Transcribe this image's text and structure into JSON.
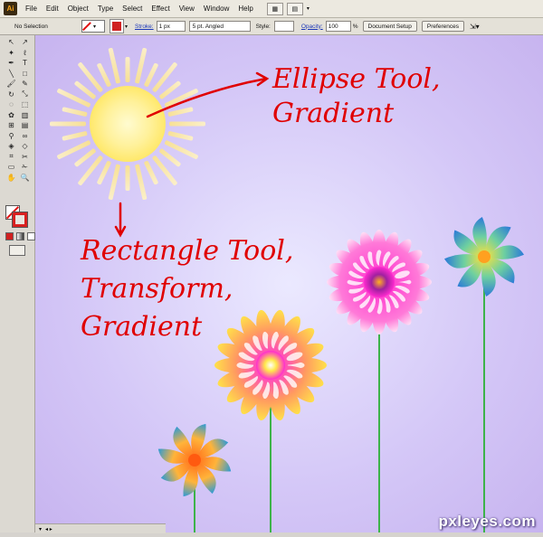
{
  "app": {
    "logo": "Ai"
  },
  "menu": [
    "File",
    "Edit",
    "Object",
    "Type",
    "Select",
    "Effect",
    "View",
    "Window",
    "Help"
  ],
  "control_bar": {
    "selection_status": "No Selection",
    "stroke_label": "Stroke:",
    "stroke_weight": "1 px",
    "brush": "5 pt. Angled",
    "style_label": "Style:",
    "opacity_label": "Opacity:",
    "opacity_value": "100",
    "opacity_unit": "%",
    "document_setup": "Document Setup",
    "preferences": "Preferences"
  },
  "tools": [
    {
      "name": "selection-tool-icon",
      "glyph": "↖"
    },
    {
      "name": "direct-selection-tool-icon",
      "glyph": "↗"
    },
    {
      "name": "magic-wand-tool-icon",
      "glyph": "✦"
    },
    {
      "name": "lasso-tool-icon",
      "glyph": "ℓ"
    },
    {
      "name": "pen-tool-icon",
      "glyph": "✒"
    },
    {
      "name": "type-tool-icon",
      "glyph": "T"
    },
    {
      "name": "line-tool-icon",
      "glyph": "╲"
    },
    {
      "name": "rectangle-tool-icon",
      "glyph": "□"
    },
    {
      "name": "paintbrush-tool-icon",
      "glyph": "🖌"
    },
    {
      "name": "pencil-tool-icon",
      "glyph": "✎"
    },
    {
      "name": "rotate-tool-icon",
      "glyph": "↻"
    },
    {
      "name": "scale-tool-icon",
      "glyph": "⤡"
    },
    {
      "name": "warp-tool-icon",
      "glyph": "◌"
    },
    {
      "name": "free-transform-tool-icon",
      "glyph": "⬚"
    },
    {
      "name": "symbol-sprayer-tool-icon",
      "glyph": "✿"
    },
    {
      "name": "column-graph-tool-icon",
      "glyph": "▥"
    },
    {
      "name": "mesh-tool-icon",
      "glyph": "⊞"
    },
    {
      "name": "gradient-tool-icon",
      "glyph": "▤"
    },
    {
      "name": "eyedropper-tool-icon",
      "glyph": "⚲"
    },
    {
      "name": "blend-tool-icon",
      "glyph": "∞"
    },
    {
      "name": "live-paint-tool-icon",
      "glyph": "◈"
    },
    {
      "name": "live-paint-selection-icon",
      "glyph": "◇"
    },
    {
      "name": "crop-tool-icon",
      "glyph": "⌗"
    },
    {
      "name": "slice-tool-icon",
      "glyph": "✂"
    },
    {
      "name": "eraser-tool-icon",
      "glyph": "▭"
    },
    {
      "name": "scissors-tool-icon",
      "glyph": "✁"
    },
    {
      "name": "hand-tool-icon",
      "glyph": "✋"
    },
    {
      "name": "zoom-tool-icon",
      "glyph": "🔍"
    }
  ],
  "colors": {
    "canvas_top": "#c9b8f2",
    "canvas_glow": "#e9e8ff",
    "annotation": "#e00000",
    "stem": "#3db34a",
    "sun_core": "#fff6a0",
    "sun_ray": "#f6d860"
  },
  "annotations": {
    "ellipse_line1": "Ellipse Tool,",
    "ellipse_line2": "Gradient",
    "rect_line1": "Rectangle Tool,",
    "rect_line2": "Transform,",
    "rect_line3": "Gradient"
  },
  "watermark": "pxleyes.com"
}
